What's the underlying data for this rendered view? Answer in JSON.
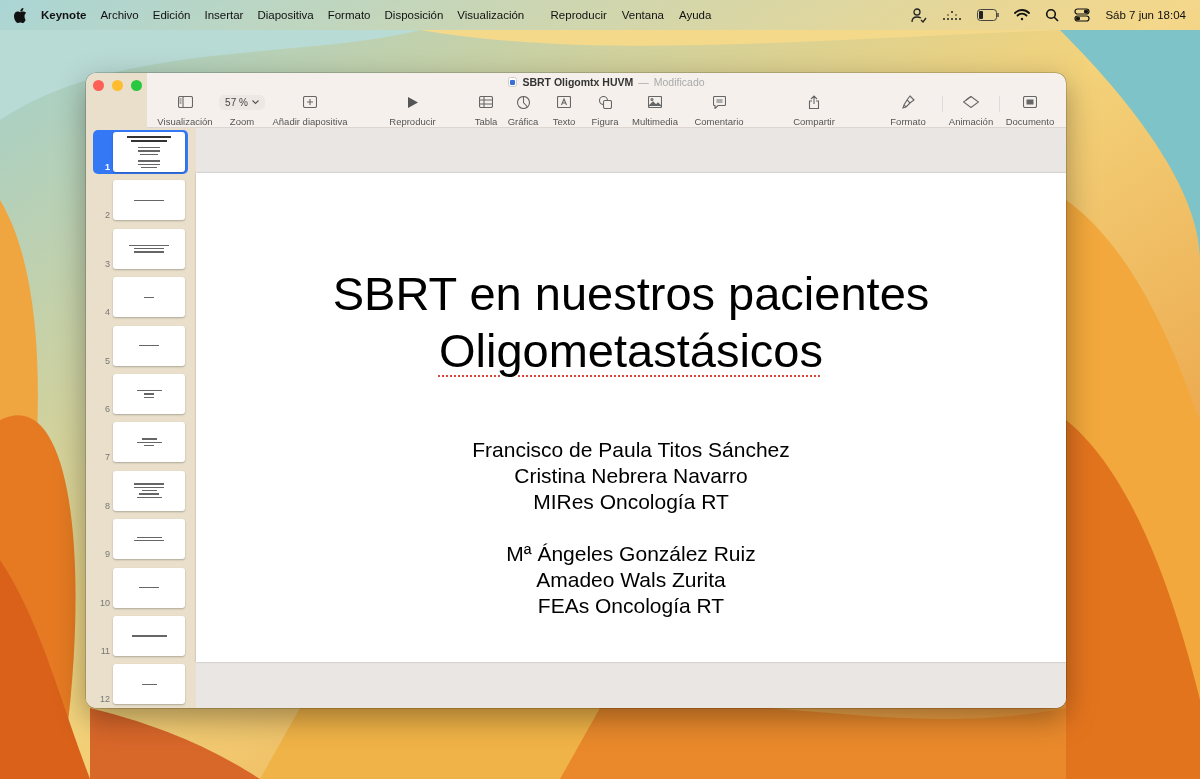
{
  "menu_bar": {
    "app": "Keynote",
    "menus": [
      "Archivo",
      "Edición",
      "Insertar",
      "Diapositiva",
      "Formato",
      "Disposición",
      "Visualización",
      "Reproducir",
      "Ventana",
      "Ayuda"
    ],
    "status_icons": [
      {
        "kind": "person"
      },
      {
        "kind": "dots"
      },
      {
        "kind": "battery"
      },
      {
        "kind": "wifi"
      },
      {
        "kind": "search"
      },
      {
        "kind": "control"
      }
    ],
    "clock": "Sáb 7 jun 18:04"
  },
  "window": {
    "title": "SBRT Oligomtx HUVM",
    "separator": "—",
    "status": "Modificado"
  },
  "toolbar": [
    {
      "kind": "sidebar",
      "label": "Visualización"
    },
    {
      "kind": "zoom",
      "label": "Zoom",
      "value": "57 %"
    },
    {
      "kind": "add",
      "label": "Añadir diapositiva"
    },
    {
      "kind": "play",
      "label": "Reproducir"
    },
    {
      "kind": "table",
      "label": "Tabla"
    },
    {
      "kind": "chart",
      "label": "Gráfica"
    },
    {
      "kind": "text",
      "label": "Texto"
    },
    {
      "kind": "shape",
      "label": "Figura"
    },
    {
      "kind": "media",
      "label": "Multimedia"
    },
    {
      "kind": "comment",
      "label": "Comentario"
    },
    {
      "kind": "share",
      "label": "Compartir"
    },
    {
      "kind": "format",
      "label": "Formato"
    },
    {
      "kind": "animate",
      "label": "Animación"
    },
    {
      "kind": "document",
      "label": "Documento"
    }
  ],
  "slides": [
    {
      "number": "1",
      "selected": true
    },
    {
      "number": "2",
      "selected": false
    },
    {
      "number": "3",
      "selected": false
    },
    {
      "number": "4",
      "selected": false
    },
    {
      "number": "5",
      "selected": false
    },
    {
      "number": "6",
      "selected": false
    },
    {
      "number": "7",
      "selected": false
    },
    {
      "number": "8",
      "selected": false
    },
    {
      "number": "9",
      "selected": false
    },
    {
      "number": "10",
      "selected": false
    },
    {
      "number": "11",
      "selected": false
    },
    {
      "number": "12",
      "selected": false
    }
  ],
  "slide": {
    "title_lines": [
      {
        "text": "SBRT en nuestros pacientes",
        "misspelled": false
      },
      {
        "text": "Oligometastásicos",
        "misspelled": true
      }
    ],
    "author_groups": [
      [
        "Francisco de Paula Titos Sánchez",
        "Cristina Nebrera Navarro",
        "MIRes Oncología RT"
      ],
      [
        "Mª Ángeles González Ruiz",
        "Amadeo Wals Zurita",
        "FEAs Oncología RT"
      ]
    ]
  }
}
